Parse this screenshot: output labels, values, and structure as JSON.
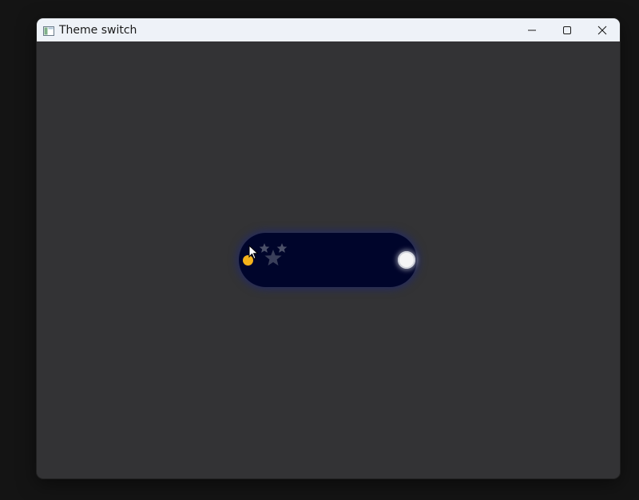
{
  "window": {
    "title": "Theme switch",
    "controls": {
      "minimize": "minimize-icon",
      "maximize": "maximize-icon",
      "close": "close-icon"
    }
  },
  "theme_switch": {
    "state": "dark",
    "track_color": "#00052b",
    "sun_color": "#f4b21a",
    "knob_color": "#f4f4f6",
    "icons": [
      "sun-icon",
      "star-icon",
      "star-icon",
      "star-icon",
      "moon-knob-icon"
    ]
  },
  "colors": {
    "window_background": "#333335",
    "titlebar_background": "#eef2f8",
    "desktop_background": "#141414"
  }
}
